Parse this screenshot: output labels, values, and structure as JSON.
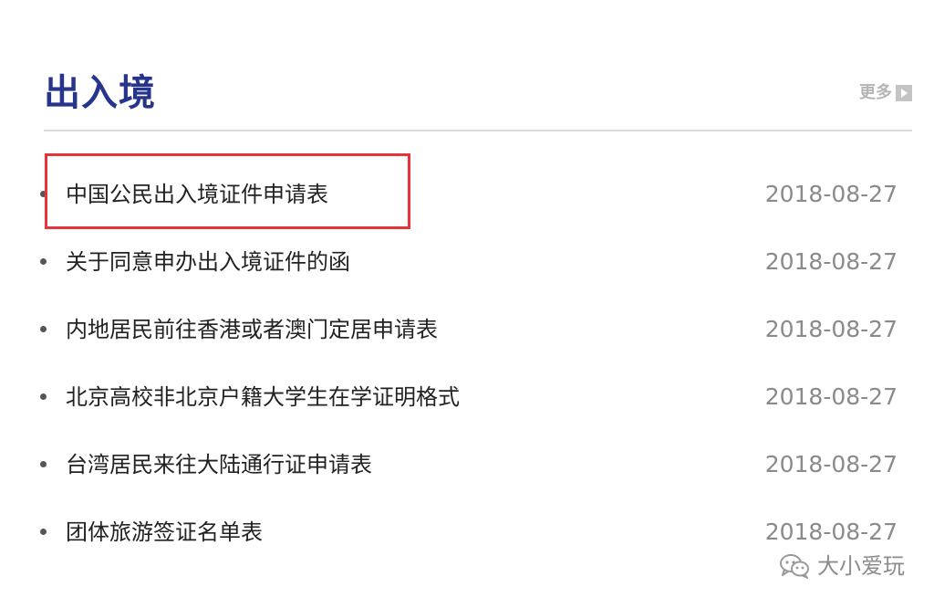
{
  "section": {
    "title": "出入境",
    "more_label": "更多"
  },
  "items": [
    {
      "title": "中国公民出入境证件申请表",
      "date": "2018-08-27"
    },
    {
      "title": "关于同意申办出入境证件的函",
      "date": "2018-08-27"
    },
    {
      "title": "内地居民前往香港或者澳门定居申请表",
      "date": "2018-08-27"
    },
    {
      "title": "北京高校非北京户籍大学生在学证明格式",
      "date": "2018-08-27"
    },
    {
      "title": "台湾居民来往大陆通行证申请表",
      "date": "2018-08-27"
    },
    {
      "title": "团体旅游签证名单表",
      "date": "2018-08-27"
    }
  ],
  "watermark": {
    "text": "大小爱玩",
    "icon": "wechat-icon"
  },
  "colors": {
    "title": "#27348b",
    "highlight": "#e8333a",
    "date": "#8a8a8a"
  }
}
